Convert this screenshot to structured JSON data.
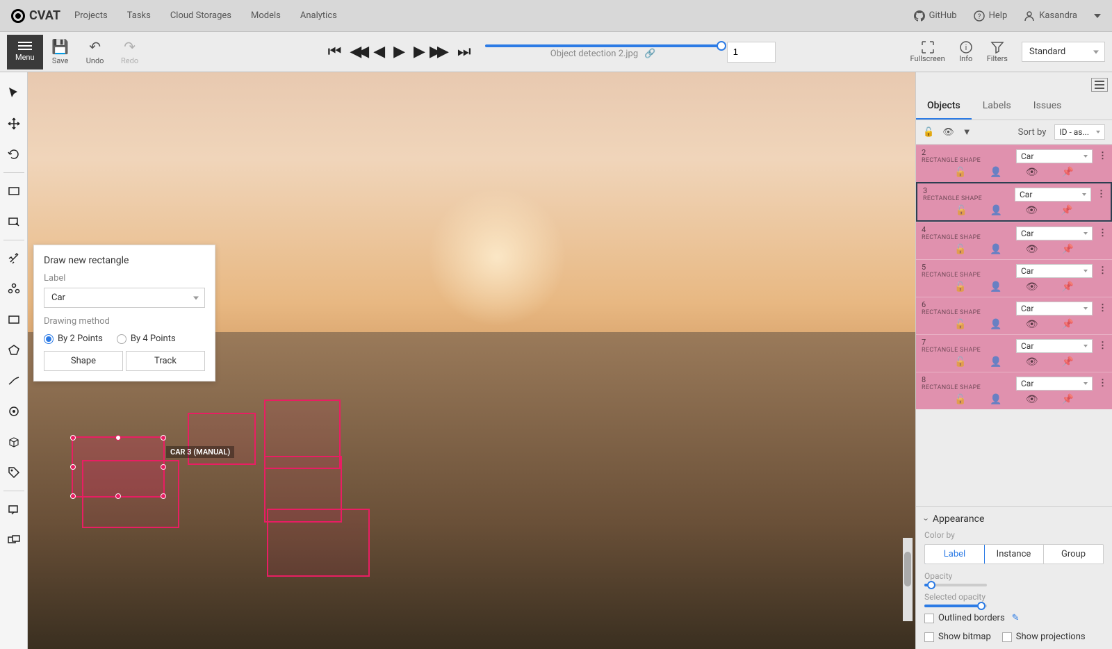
{
  "brand": "CVAT",
  "nav": {
    "projects": "Projects",
    "tasks": "Tasks",
    "cloud": "Cloud Storages",
    "models": "Models",
    "analytics": "Analytics"
  },
  "rightNav": {
    "github": "GitHub",
    "help": "Help",
    "user": "Kasandra"
  },
  "toolbar": {
    "menu": "Menu",
    "save": "Save",
    "undo": "Undo",
    "redo": "Redo",
    "fullscreen": "Fullscreen",
    "info": "Info",
    "filters": "Filters",
    "workspace": "Standard"
  },
  "filename": "Object detection 2.jpg",
  "frame": "1",
  "popup": {
    "title": "Draw new rectangle",
    "labelLabel": "Label",
    "labelValue": "Car",
    "methodLabel": "Drawing method",
    "opt1": "By 2 Points",
    "opt2": "By 4 Points",
    "shape": "Shape",
    "track": "Track"
  },
  "selectedBoxLabel": "CAR 3 (MANUAL)",
  "tabs": {
    "objects": "Objects",
    "labels": "Labels",
    "issues": "Issues"
  },
  "sort": {
    "label": "Sort by",
    "value": "ID - as..."
  },
  "shapeType": "RECTANGLE SHAPE",
  "objects": [
    {
      "id": "2",
      "label": "Car"
    },
    {
      "id": "3",
      "label": "Car"
    },
    {
      "id": "4",
      "label": "Car"
    },
    {
      "id": "5",
      "label": "Car"
    },
    {
      "id": "6",
      "label": "Car"
    },
    {
      "id": "7",
      "label": "Car"
    },
    {
      "id": "8",
      "label": "Car"
    }
  ],
  "appearance": {
    "title": "Appearance",
    "colorBy": "Color by",
    "label": "Label",
    "instance": "Instance",
    "group": "Group",
    "opacity": "Opacity",
    "selOpacity": "Selected opacity",
    "outlined": "Outlined borders",
    "bitmap": "Show bitmap",
    "projections": "Show projections"
  }
}
